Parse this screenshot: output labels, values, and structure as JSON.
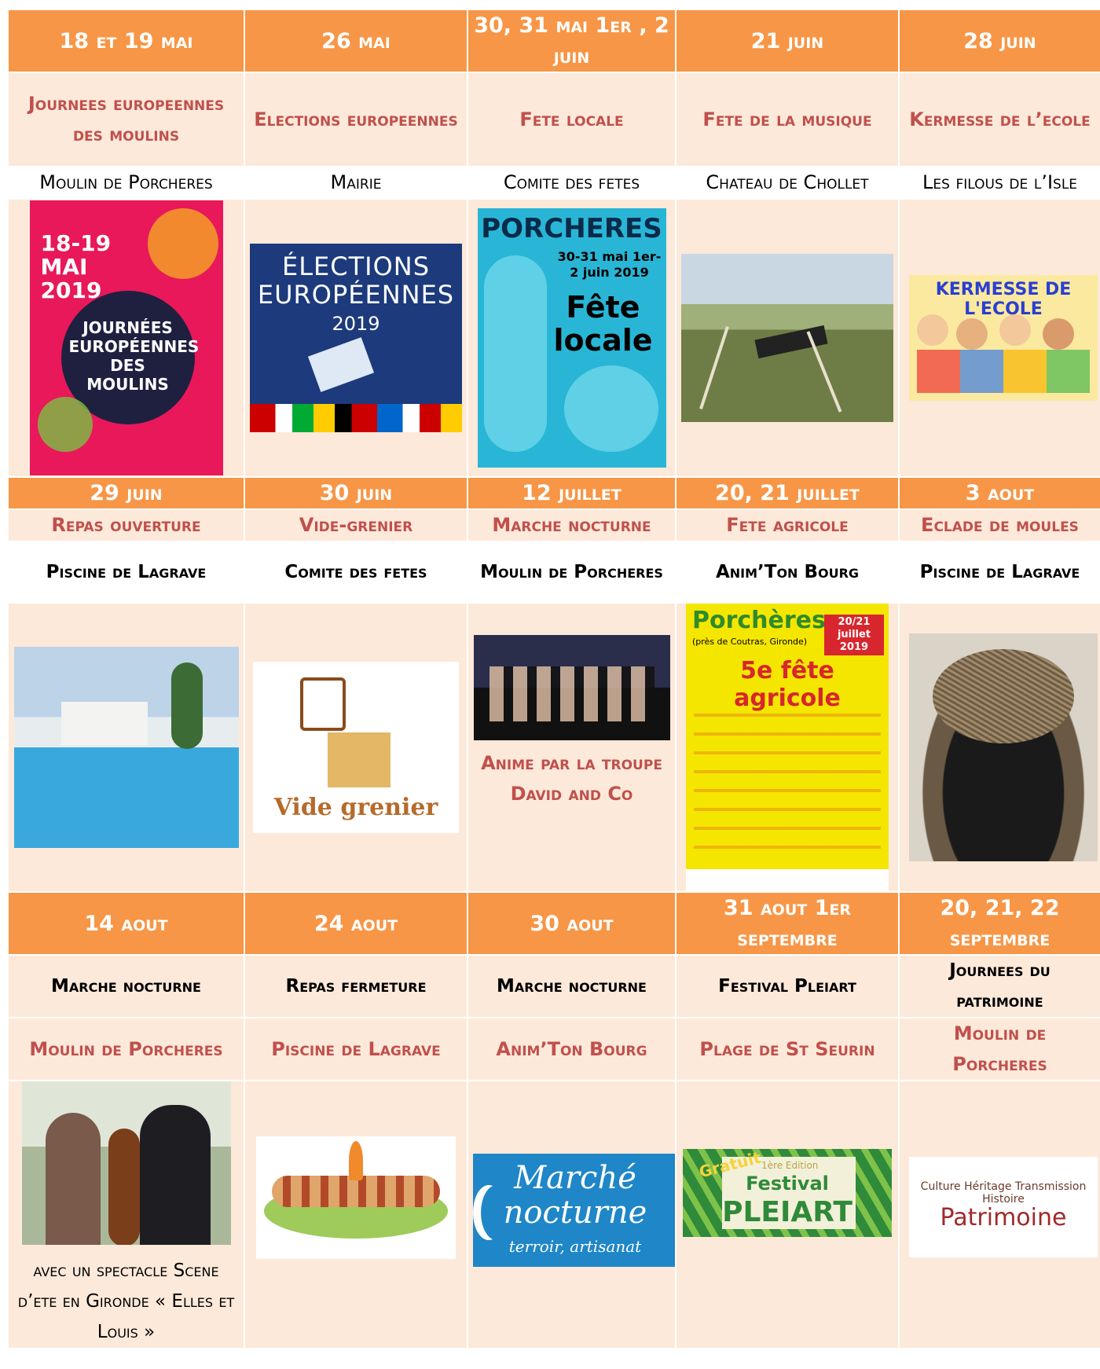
{
  "rows": [
    {
      "dates": [
        "18 et 19 mai",
        "26 mai",
        "30, 31 mai 1er , 2 juin",
        "21 juin",
        "28 juin"
      ],
      "events": [
        "Journees europeennes des moulins",
        "Elections europeennes",
        "Fete locale",
        "Fete de la musique",
        "Kermesse de l’ecole"
      ],
      "places": [
        "Moulin de Porcheres",
        "Mairie",
        "Comite des fetes",
        "Chateau de Chollet",
        "Les filous de l’Isle"
      ]
    },
    {
      "dates": [
        "29 juin",
        "30 juin",
        "12 juillet",
        "20, 21 juillet",
        "3 aout"
      ],
      "events": [
        "Repas ouverture",
        "Vide-grenier",
        "Marche nocturne",
        "Fete agricole",
        "Eclade de moules"
      ],
      "places": [
        "Piscine de Lagrave",
        "Comite des fetes",
        "Moulin de Porcheres",
        "Anim’Ton Bourg",
        "Piscine de Lagrave"
      ],
      "note": "Anime par la troupe David and Co"
    },
    {
      "dates": [
        "14 aout",
        "24 aout",
        "30 aout",
        "31 aout 1er septembre",
        "20, 21, 22 septembre"
      ],
      "events": [
        "Marche nocturne",
        "Repas fermeture",
        "Marche nocturne",
        "Festival Pleiart",
        "Journees du patrimoine"
      ],
      "places": [
        "Moulin de Porcheres",
        "Piscine de Lagrave",
        "Anim’Ton Bourg",
        "Plage de St Seurin",
        "Moulin de Porcheres"
      ],
      "note": "avec un spectacle Scene d’ete en Gironde « Elles et Louis »"
    }
  ],
  "posters": {
    "moulins": {
      "date": "18-19 MAI 2019",
      "title": "JOURNÉES EUROPÉENNES DES MOULINS"
    },
    "elections": {
      "line1": "ÉLECTIONS",
      "line2": "EUROPÉENNES",
      "year": "2019"
    },
    "porcheres": {
      "town": "PORCHERES",
      "dates": "30-31 mai 1er-2 juin 2019",
      "title": "Fête locale"
    },
    "kermesse": {
      "title": "KERMESSE DE L'ECOLE"
    },
    "vide": {
      "title": "Vide grenier"
    },
    "agricole": {
      "town": "Porchères",
      "loc": "(près de Coutras, Gironde)",
      "dates": "20/21 juillet 2019",
      "title": "5e fête agricole"
    },
    "marche": {
      "line1": "Marché",
      "line2": "nocturne",
      "line3": "terroir, artisanat"
    },
    "pleiart": {
      "free": "Gratuit",
      "edition": "1ère Edition",
      "line1": "Festival",
      "line2": "PLEIART"
    },
    "patrimoine": {
      "title": "Patrimoine",
      "words": "Culture Héritage Transmission Histoire"
    }
  },
  "colors": {
    "header": "#f79646",
    "row": "#fde9d9",
    "accent": "#c0504d"
  }
}
